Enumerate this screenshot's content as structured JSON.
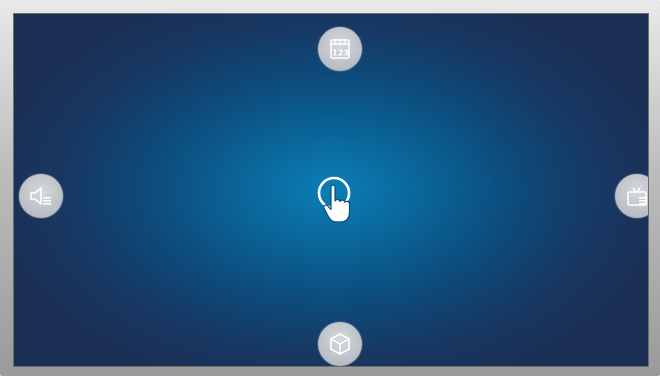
{
  "screen": {
    "title": "",
    "center_icon": "touch-pointer-icon",
    "edge_buttons": [
      {
        "position": "top",
        "icon": "keypad-123-icon"
      },
      {
        "position": "left",
        "icon": "volume-menu-icon"
      },
      {
        "position": "right",
        "icon": "channel-menu-icon"
      },
      {
        "position": "bottom",
        "icon": "smart-hub-cube-icon"
      }
    ],
    "keypad_glyph": "123"
  },
  "colors": {
    "screen_center": "#0a7fb6",
    "screen_edge": "#1b2f55",
    "button_fill": "#c3c8cd",
    "icon_color": "#ffffff",
    "bezel": "#bdbdbd"
  }
}
